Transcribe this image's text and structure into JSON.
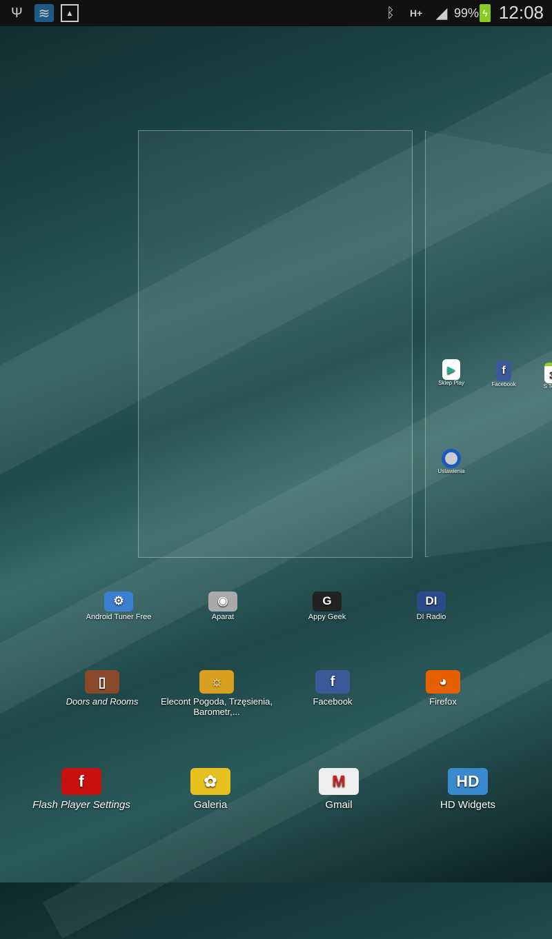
{
  "status_bar": {
    "battery": "99%",
    "time": "12:08",
    "network": "H+"
  },
  "preview_page": {
    "apps": [
      {
        "label": "Sklep Play"
      },
      {
        "label": "Facebook"
      },
      {
        "label": "S Term"
      },
      {
        "label": "Ustawienia"
      }
    ]
  },
  "rows": [
    [
      {
        "label": "Android Tuner Free",
        "color": "#3a7fd0"
      },
      {
        "label": "Aparat",
        "color": "#aaaaaa"
      },
      {
        "label": "Appy Geek",
        "color": "#222222"
      },
      {
        "label": "DI Radio",
        "color": "#2a4a8a"
      }
    ],
    [
      {
        "label": "Doors and Rooms",
        "color": "#8a4a2a"
      },
      {
        "label": "Elecont Pogoda, Trzęsienia, Barometr,...",
        "color": "#d9a020"
      },
      {
        "label": "Facebook",
        "color": "#3b5998"
      },
      {
        "label": "Firefox",
        "color": "#e66000"
      }
    ],
    [
      {
        "label": "Flash Player Settings",
        "color": "#c81010"
      },
      {
        "label": "Galeria",
        "color": "#e8c020"
      },
      {
        "label": "Gmail",
        "color": "#eeeeee"
      },
      {
        "label": "HD Widgets",
        "color": "#3a8ad0"
      }
    ]
  ]
}
